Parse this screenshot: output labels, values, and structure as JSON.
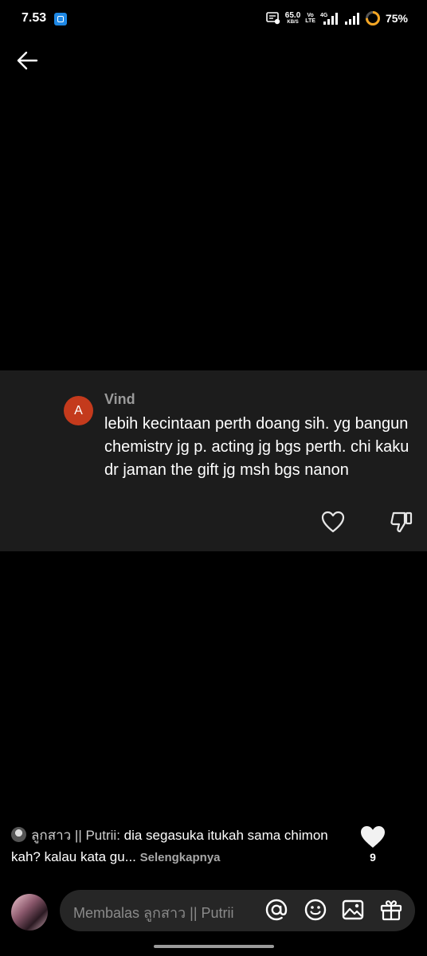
{
  "status_bar": {
    "time": "7.53",
    "network_speed": "65.0",
    "network_speed_unit": "KB/S",
    "volte_top": "Vo",
    "volte_bottom": "LTE",
    "network_type": "4G",
    "battery": "75%"
  },
  "comment": {
    "avatar_letter": "A",
    "author": "Vind",
    "text": "lebih kecintaan perth doang sih. yg bangun chemistry jg p. acting jg bgs perth. chi kaku dr jaman the gift jg msh bgs nanon"
  },
  "post": {
    "creator_name": "ลูกสาว || Putrii:",
    "caption": " dia segasuka itukah sama chimon kah? kalau kata gu...",
    "see_more": "Selengkapnya",
    "like_count": "9"
  },
  "reply": {
    "placeholder": "Membalas ลูกสาว || Putrii"
  },
  "icons": [
    "back-arrow-icon",
    "heart-outline-icon",
    "thumbs-down-icon",
    "heart-filled-icon",
    "at-icon",
    "emoji-icon",
    "image-icon",
    "gift-icon"
  ]
}
